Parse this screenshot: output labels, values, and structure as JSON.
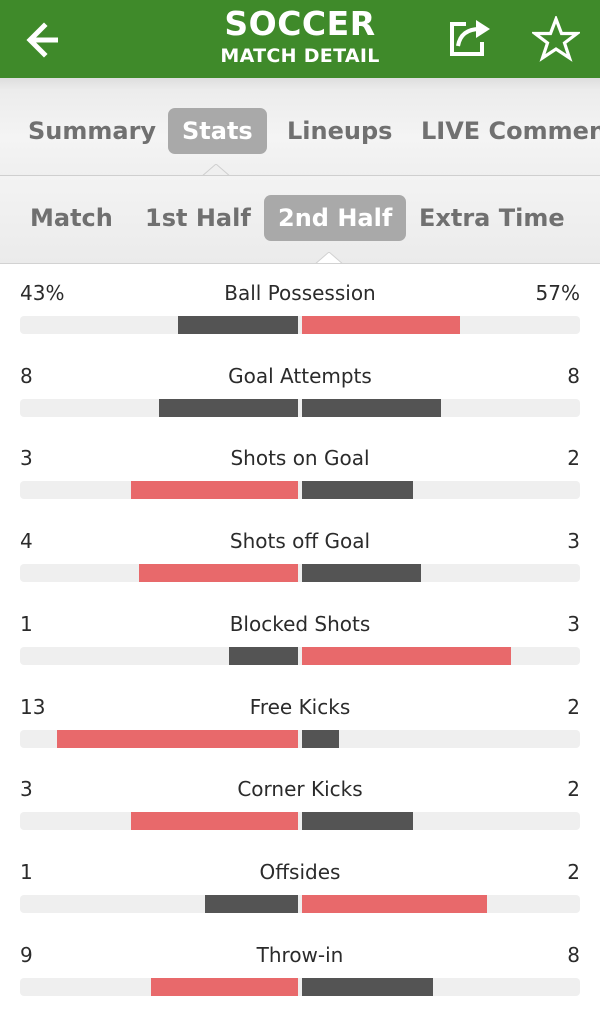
{
  "header": {
    "title": "SOCCER",
    "subtitle": "MATCH DETAIL",
    "back_icon": "back-arrow-icon",
    "share_icon": "share-icon",
    "favorite_icon": "star-icon",
    "background_color": "#3f8a2a"
  },
  "main_tabs": [
    {
      "label": "Summary",
      "active": false
    },
    {
      "label": "Stats",
      "active": true
    },
    {
      "label": "Lineups",
      "active": false
    },
    {
      "label": "LIVE Commen",
      "active": false
    }
  ],
  "period_tabs": [
    {
      "label": "Match",
      "active": false
    },
    {
      "label": "1st Half",
      "active": false
    },
    {
      "label": "2nd Half",
      "active": true
    },
    {
      "label": "Extra Time",
      "active": false
    }
  ],
  "colors": {
    "leading": "#e8696b",
    "trailing": "#545454",
    "track": "#efefef"
  },
  "stats": [
    {
      "label": "Ball Possession",
      "left": "43%",
      "right": "57%",
      "left_value": 43,
      "right_value": 57,
      "left_color": "dark",
      "right_color": "red"
    },
    {
      "label": "Goal Attempts",
      "left": "8",
      "right": "8",
      "left_value": 8,
      "right_value": 8,
      "left_color": "dark",
      "right_color": "dark"
    },
    {
      "label": "Shots on Goal",
      "left": "3",
      "right": "2",
      "left_value": 3,
      "right_value": 2,
      "left_color": "red",
      "right_color": "dark"
    },
    {
      "label": "Shots off Goal",
      "left": "4",
      "right": "3",
      "left_value": 4,
      "right_value": 3,
      "left_color": "red",
      "right_color": "dark"
    },
    {
      "label": "Blocked Shots",
      "left": "1",
      "right": "3",
      "left_value": 1,
      "right_value": 3,
      "left_color": "dark",
      "right_color": "red"
    },
    {
      "label": "Free Kicks",
      "left": "13",
      "right": "2",
      "left_value": 13,
      "right_value": 2,
      "left_color": "red",
      "right_color": "dark"
    },
    {
      "label": "Corner Kicks",
      "left": "3",
      "right": "2",
      "left_value": 3,
      "right_value": 2,
      "left_color": "red",
      "right_color": "dark"
    },
    {
      "label": "Offsides",
      "left": "1",
      "right": "2",
      "left_value": 1,
      "right_value": 2,
      "left_color": "dark",
      "right_color": "red"
    },
    {
      "label": "Throw-in",
      "left": "9",
      "right": "8",
      "left_value": 9,
      "right_value": 8,
      "left_color": "red",
      "right_color": "dark"
    }
  ]
}
